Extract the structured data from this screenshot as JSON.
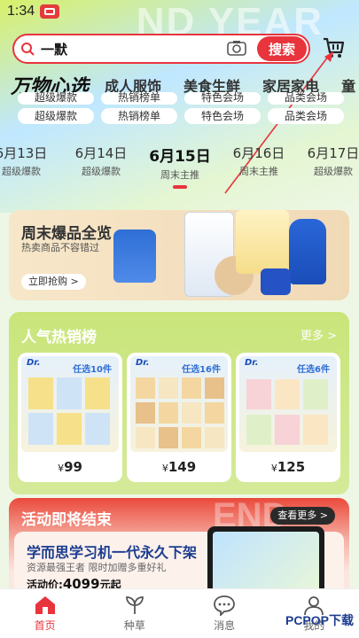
{
  "status_bar": {
    "time": "1:34",
    "app_badge": "sales"
  },
  "hero": {
    "watermark": "ND YEAR"
  },
  "search": {
    "query": "一默",
    "button_label": "搜索"
  },
  "category_tabs": {
    "brand": "万物心选",
    "items": [
      "成人服饰",
      "美食生鲜",
      "家居家电",
      "童"
    ]
  },
  "pills": [
    [
      "超级爆款",
      "热销榜单",
      "特色会场",
      "品类会场"
    ],
    [
      "超级爆款",
      "热销榜单",
      "特色会场",
      "品类会场"
    ]
  ],
  "dates": [
    {
      "date": "6月13日",
      "sub": "超级爆款",
      "active": false
    },
    {
      "date": "6月14日",
      "sub": "超级爆款",
      "active": false
    },
    {
      "date": "6月15日",
      "sub": "周末主推",
      "active": true
    },
    {
      "date": "6月16日",
      "sub": "周末主推",
      "active": false
    },
    {
      "date": "6月17日",
      "sub": "超级爆款",
      "active": false
    }
  ],
  "weekend_banner": {
    "title": "周末爆品全览",
    "subtitle": "热卖商品不容错过",
    "cta": "立即抢购 >"
  },
  "hot_ranking": {
    "title": "人气热销榜",
    "more": "更多 >",
    "cards": [
      {
        "brand": "Dr.",
        "tag": "任选10件",
        "price": "99"
      },
      {
        "brand": "Dr.",
        "tag": "任选16件",
        "price": "149"
      },
      {
        "brand": "Dr.",
        "tag": "任选6件",
        "price": "125"
      }
    ],
    "currency": "¥"
  },
  "flash_sale": {
    "title": "活动即将结束",
    "more": "查看更多 >",
    "watermark": "END",
    "product_title": "学而思学习机一代永久下架",
    "product_desc": "资源最强王者 限时加赠多重好礼",
    "price_label": "活动价:",
    "price_value": "4099",
    "price_unit": "元起"
  },
  "tabbar": {
    "items": [
      {
        "label": "首页",
        "icon": "home-icon",
        "active": true
      },
      {
        "label": "种草",
        "icon": "leaf-icon",
        "active": false
      },
      {
        "label": "消息",
        "icon": "message-icon",
        "active": false
      },
      {
        "label": "我的",
        "icon": "user-icon",
        "active": false
      }
    ]
  },
  "watermark_logo": "PCPOP下载",
  "colors": {
    "accent": "#e8343d",
    "hot_bg": "#c9e57a",
    "banner_bg": "#f7e7c9"
  }
}
